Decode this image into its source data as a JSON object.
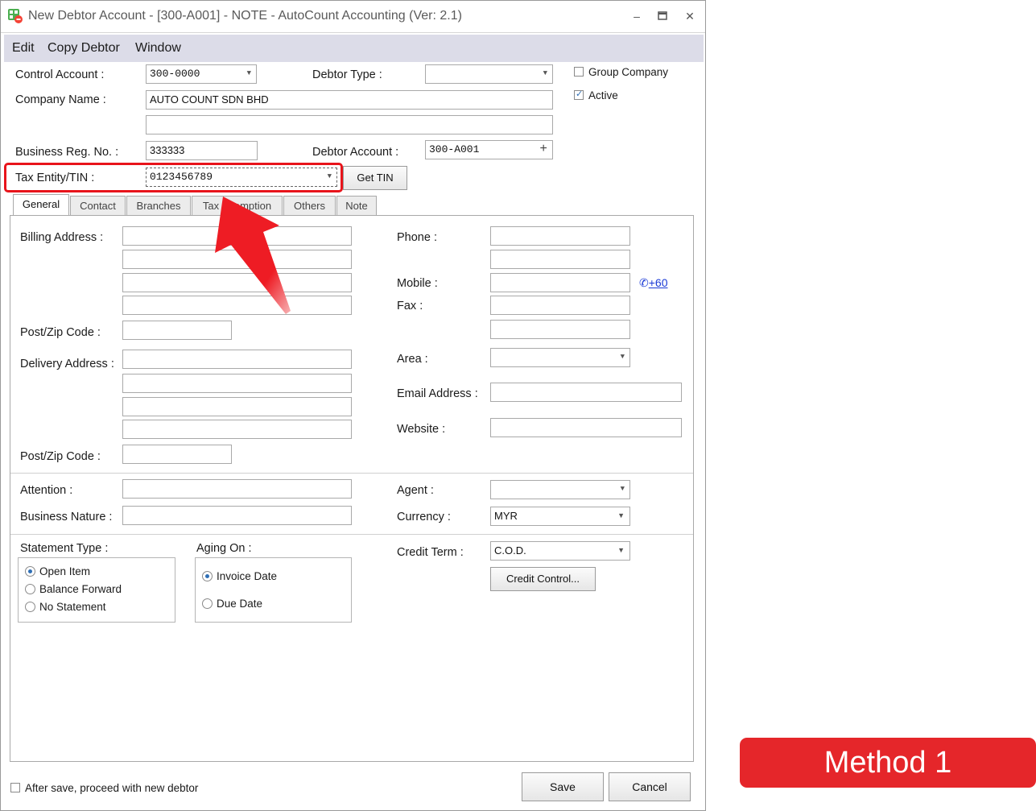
{
  "window": {
    "title": "New Debtor Account - [300-A001] - NOTE - AutoCount Accounting (Ver: 2.1)"
  },
  "menu": [
    "Edit",
    "Copy Debtor",
    "Window"
  ],
  "form": {
    "control_account_label": "Control Account :",
    "control_account_value": "300-0000",
    "debtor_type_label": "Debtor Type :",
    "debtor_type_value": "",
    "group_company_label": "Group Company",
    "group_company_checked": false,
    "active_label": "Active",
    "active_checked": true,
    "company_name_label": "Company Name :",
    "company_name_value": "AUTO COUNT SDN BHD",
    "company_name2_value": "",
    "business_reg_label": "Business Reg. No. :",
    "business_reg_value": "333333",
    "debtor_account_label": "Debtor Account :",
    "debtor_account_value": "300-A001",
    "tin_label": "Tax Entity/TIN :",
    "tin_value": "0123456789",
    "get_tin_label": "Get TIN"
  },
  "tabs": [
    "General",
    "Contact",
    "Branches",
    "Tax Exemption",
    "Others",
    "Note"
  ],
  "active_tab": "General",
  "general": {
    "billing_address_label": "Billing Address :",
    "post_zip_label": "Post/Zip Code :",
    "delivery_address_label": "Delivery Address :",
    "delivery_post_zip_label": "Post/Zip Code :",
    "phone_label": "Phone :",
    "mobile_label": "Mobile :",
    "mobile_link": "+60",
    "fax_label": "Fax :",
    "area_label": "Area :",
    "email_label": "Email  Address :",
    "website_label": "Website :",
    "attention_label": "Attention :",
    "business_nature_label": "Business Nature :",
    "agent_label": "Agent :",
    "currency_label": "Currency :",
    "currency_value": "MYR",
    "statement_type_label": "Statement Type :",
    "statement_options": [
      "Open Item",
      "Balance Forward",
      "No Statement"
    ],
    "statement_selected": "Open Item",
    "aging_on_label": "Aging On :",
    "aging_options": [
      "Invoice Date",
      "Due Date"
    ],
    "aging_selected": "Invoice Date",
    "credit_term_label": "Credit Term :",
    "credit_term_value": "C.O.D.",
    "credit_control_label": "Credit Control..."
  },
  "footer": {
    "proceed_label": "After save, proceed with new debtor",
    "proceed_checked": false,
    "save_label": "Save",
    "cancel_label": "Cancel"
  },
  "annotation": {
    "method_label": "Method 1"
  },
  "colors": {
    "highlight": "#e8141b",
    "banner": "#e5262a",
    "arrow": "#ee1c24",
    "menubar": "#dcdce8"
  }
}
